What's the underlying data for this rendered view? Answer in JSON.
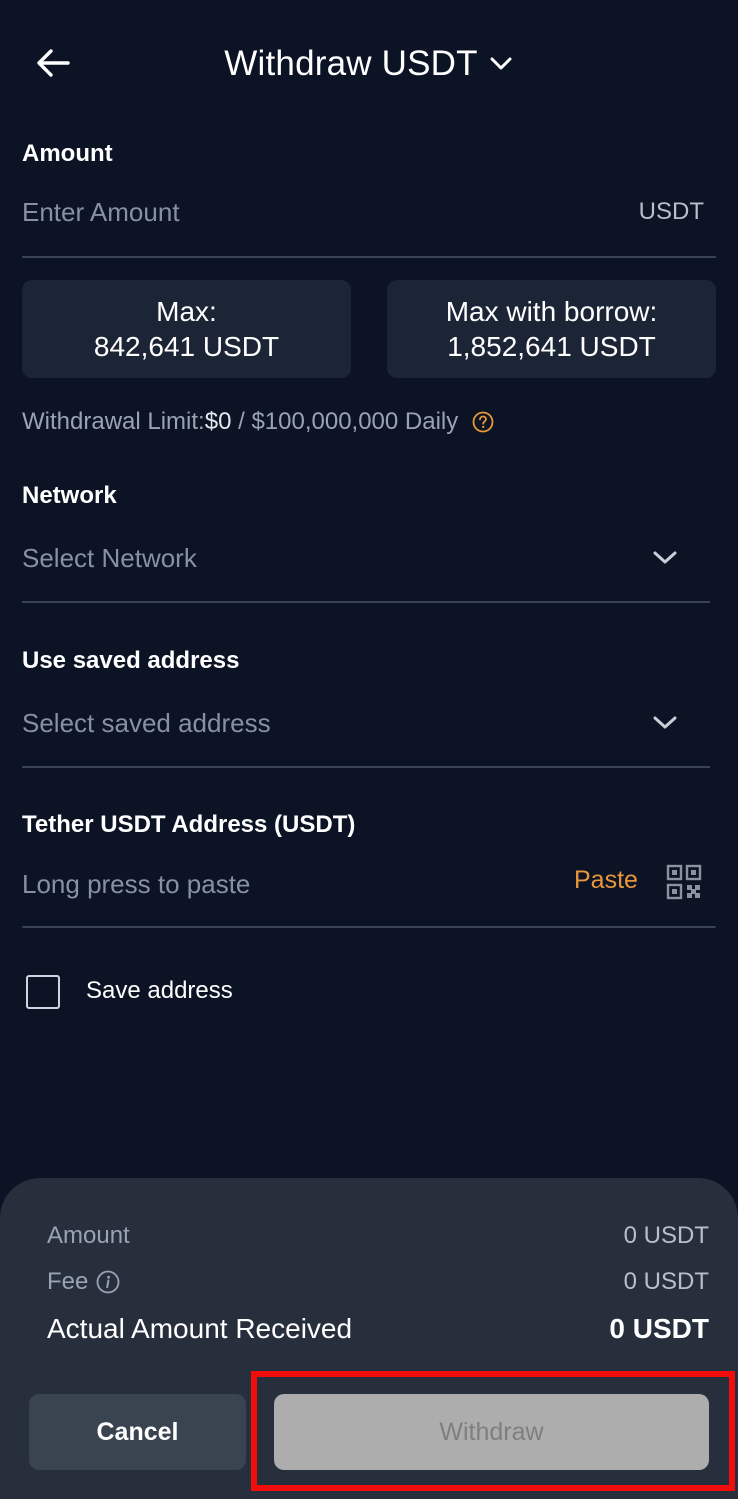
{
  "header": {
    "title": "Withdraw USDT",
    "back_icon": "arrow-left-icon",
    "title_dropdown_icon": "chevron-down-icon"
  },
  "amount": {
    "label": "Amount",
    "placeholder": "Enter Amount",
    "value": "",
    "unit": "USDT"
  },
  "max_buttons": {
    "max": {
      "line1": "Max:",
      "line2": "842,641 USDT"
    },
    "max_borrow": {
      "line1": "Max with borrow:",
      "line2": "1,852,641 USDT"
    }
  },
  "withdrawal_limit": {
    "label": "Withdrawal Limit:",
    "used": "$0",
    "separator": " / ",
    "total": "$100,000,000 Daily",
    "help_icon": "question-circle-icon"
  },
  "network": {
    "label": "Network",
    "placeholder": "Select Network"
  },
  "saved_address": {
    "label": "Use saved address",
    "placeholder": "Select saved address"
  },
  "tether_address": {
    "label": "Tether USDT Address (USDT)",
    "placeholder": "Long press to paste",
    "value": "",
    "paste_label": "Paste",
    "qr_icon": "qr-code-icon"
  },
  "save_address": {
    "label": "Save address",
    "checked": false
  },
  "summary": {
    "amount_label": "Amount",
    "amount_value": "0 USDT",
    "fee_label": "Fee",
    "fee_value": "0 USDT",
    "actual_label": "Actual Amount Received",
    "actual_value": "0 USDT"
  },
  "actions": {
    "cancel_label": "Cancel",
    "withdraw_label": "Withdraw"
  },
  "colors": {
    "background": "#0b1324",
    "card": "#1c2536",
    "sheet": "#272f3d",
    "accent": "#e8963c",
    "highlight_frame": "#f20d0d",
    "disabled_button": "#adadad"
  }
}
